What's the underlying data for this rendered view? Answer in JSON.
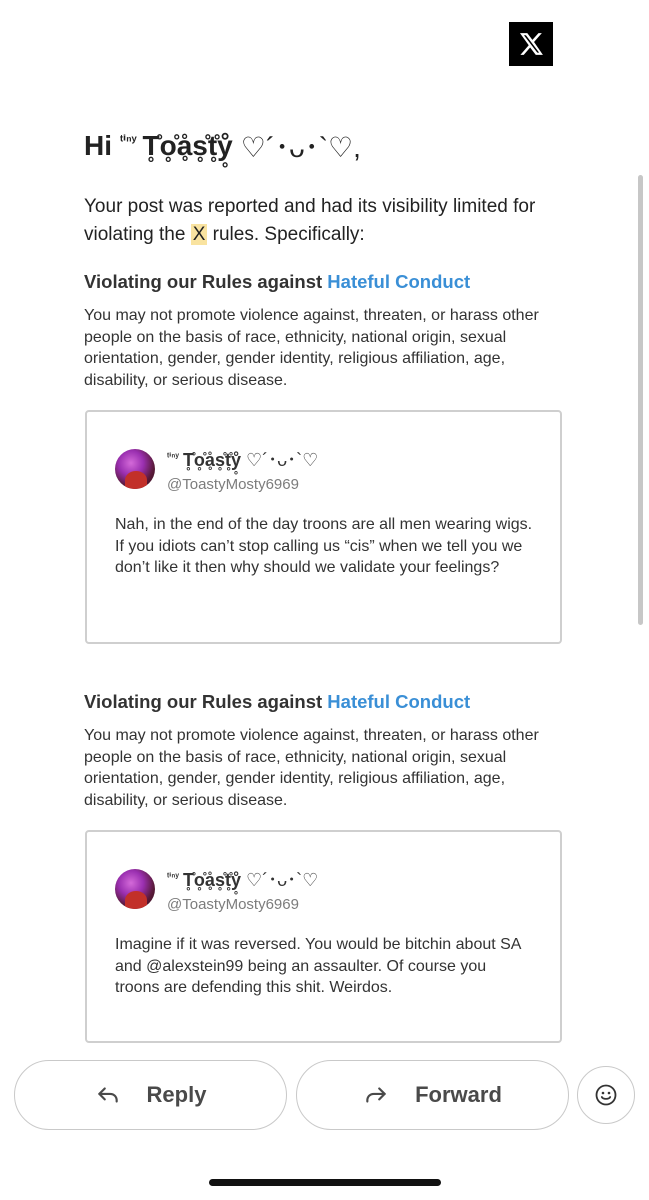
{
  "logo": {
    "icon": "x-logo-icon"
  },
  "greeting": {
    "hi": "Hi",
    "name_sup": "ᵗⁱⁿʸ",
    "name": "T̥̊o̥̊ḁ̊s̥̊t̥̊ẙ̥",
    "hearts": "♡´･ᴗ･`♡,"
  },
  "intro": {
    "before": "Your post was reported and had its visibility limited for violating the ",
    "highlight": "X",
    "after": " rules. Specifically:"
  },
  "violations": [
    {
      "title_prefix": "Violating our Rules against ",
      "title_link": "Hateful Conduct",
      "rule_text": "You may not promote violence against, threaten, or harass other people on the basis of race, ethnicity, national origin, sexual orientation, gender, gender identity, religious affiliation, age, disability, or serious disease.",
      "post": {
        "name_sup": "ᵗⁱⁿʸ",
        "name": "T̥̊o̥̊ḁ̊s̥̊t̥̊ẙ̥",
        "hearts": "♡´･ᴗ･`♡",
        "handle": "@ToastyMosty6969",
        "body": "Nah, in the end of the day troons are all men wearing wigs. If you idiots can’t stop calling us “cis” when we tell you we don’t like it then why should we validate your feelings?"
      }
    },
    {
      "title_prefix": "Violating our Rules against ",
      "title_link": "Hateful Conduct",
      "rule_text": "You may not promote violence against, threaten, or harass other people on the basis of race, ethnicity, national origin, sexual orientation, gender, gender identity, religious affiliation, age, disability, or serious disease.",
      "post": {
        "name_sup": "ᵗⁱⁿʸ",
        "name": "T̥̊o̥̊ḁ̊s̥̊t̥̊ẙ̥",
        "hearts": "♡´･ᴗ･`♡",
        "handle": "@ToastyMosty6969",
        "body": "Imagine if it was reversed. You would be bitchin about SA and @alexstein99 being an assaulter. Of course you troons are defending this shit. Weirdos."
      }
    }
  ],
  "actions": {
    "reply_label": "Reply",
    "reply_icon": "reply-arrow-icon",
    "forward_label": "Forward",
    "forward_icon": "forward-arrow-icon",
    "emoji_icon": "smiley-icon"
  }
}
